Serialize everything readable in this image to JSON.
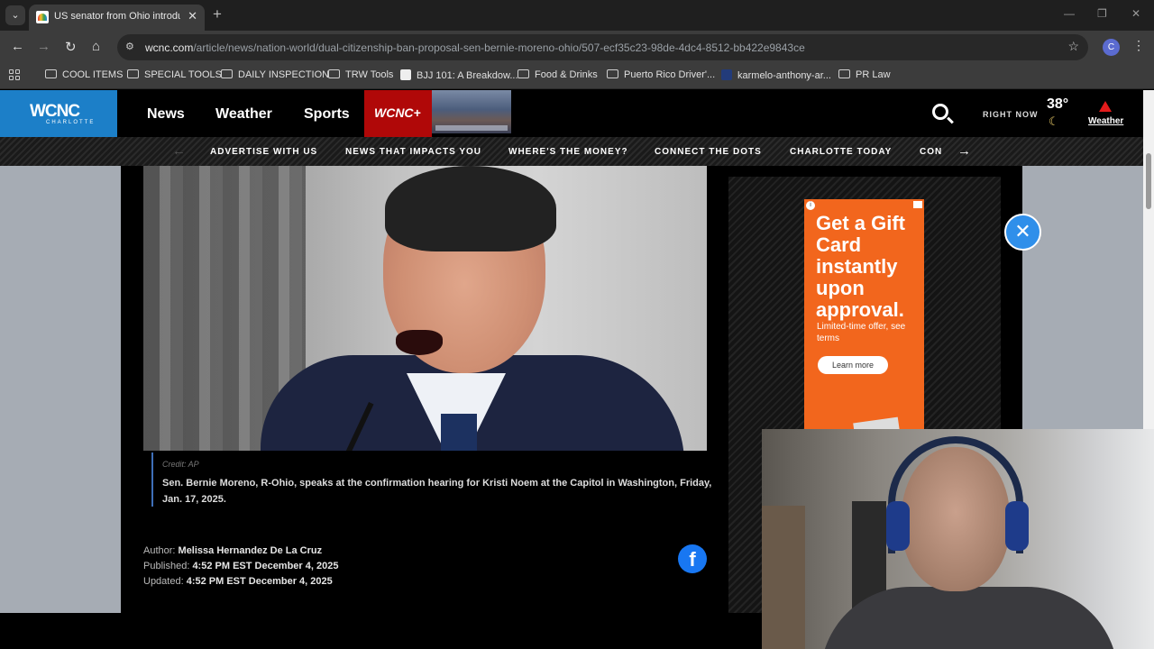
{
  "browser": {
    "tab_title": "US senator from Ohio introduc",
    "url_host": "wcnc.com",
    "url_path": "/article/news/nation-world/dual-citizenship-ban-proposal-sen-bernie-moreno-ohio/507-ecf35c23-98de-4dc4-8512-bb422e9843ce",
    "profile_initial": "C",
    "bookmarks": [
      {
        "label": "COOL ITEMS",
        "type": "folder"
      },
      {
        "label": "SPECIAL TOOLS",
        "type": "folder"
      },
      {
        "label": "DAILY INSPECTION",
        "type": "folder"
      },
      {
        "label": "TRW Tools",
        "type": "folder"
      },
      {
        "label": "BJJ 101: A Breakdow...",
        "type": "page"
      },
      {
        "label": "Food & Drinks",
        "type": "folder"
      },
      {
        "label": "Puerto Rico Driver'...",
        "type": "folder"
      },
      {
        "label": "karmelo-anthony-ar...",
        "type": "page"
      },
      {
        "label": "PR Law",
        "type": "folder"
      }
    ]
  },
  "site": {
    "logo_main": "WCNC",
    "logo_sub": "CHARLOTTE",
    "nav": [
      "News",
      "Weather",
      "Sports"
    ],
    "plus_label": "WCNC+",
    "right_now": "RIGHT NOW",
    "temp": "38°",
    "weather_label": "Weather",
    "subnav": [
      "ADVERTISE WITH US",
      "NEWS THAT IMPACTS YOU",
      "WHERE'S THE MONEY?",
      "CONNECT THE DOTS",
      "CHARLOTTE TODAY",
      "CON"
    ]
  },
  "article": {
    "credit": "Credit: AP",
    "caption": "Sen. Bernie Moreno, R-Ohio, speaks at the confirmation hearing for Kristi Noem at the Capitol in Washington, Friday, Jan. 17, 2025.",
    "author_label": "Author:",
    "author": "Melissa Hernandez De La Cruz",
    "published_label": "Published:",
    "published": "4:52 PM EST December 4, 2025",
    "updated_label": "Updated:",
    "updated": "4:52 PM EST December 4, 2025"
  },
  "ad": {
    "headline": "Get a Gift Card instantly upon approval.",
    "sub": "Limited-time offer, see terms",
    "button": "Learn more"
  },
  "icons": {
    "close": "close-icon",
    "facebook": "facebook-icon",
    "search": "search-icon"
  }
}
